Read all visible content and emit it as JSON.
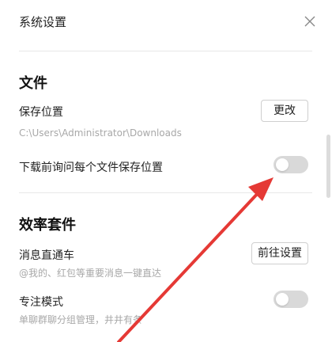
{
  "window": {
    "title": "系统设置"
  },
  "sections": {
    "file": {
      "title": "文件",
      "save_location_label": "保存位置",
      "change_button": "更改",
      "save_path": "C:\\Users\\Administrator\\Downloads",
      "ask_each_time_label": "下载前询问每个文件保存位置",
      "ask_each_time_on": false
    },
    "efficiency": {
      "title": "效率套件",
      "direct_label": "消息直通车",
      "direct_desc": "@我的、红包等重要消息一键直达",
      "goto_settings_button": "前往设置",
      "focus_label": "专注模式",
      "focus_desc": "单聊群聊分组管理，井井有条",
      "focus_on": false
    }
  },
  "colors": {
    "annotation_arrow": "#e53935",
    "toggle_off": "#d9d9d9"
  },
  "icons": {
    "close": "close-icon"
  }
}
